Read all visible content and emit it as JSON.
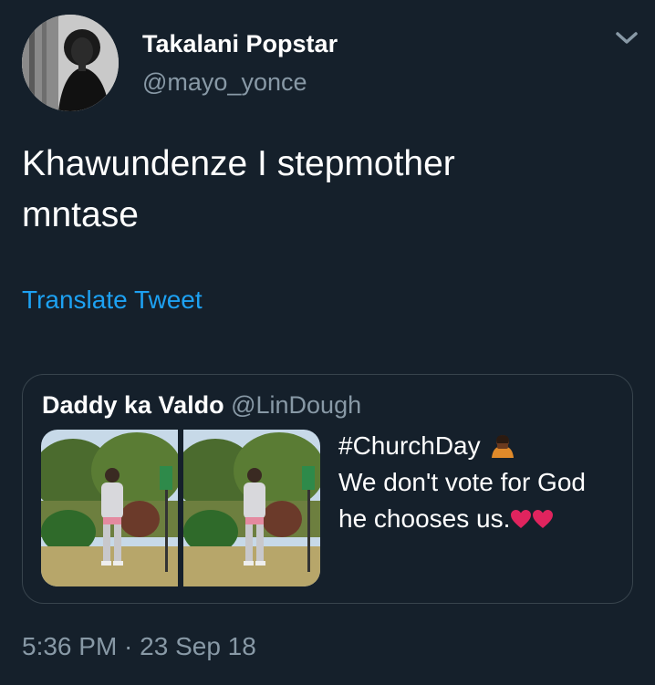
{
  "tweet": {
    "author_name": "Takalani Popstar",
    "author_handle": "@mayo_yonce",
    "text_line1": "Khawundenze I stepmother",
    "text_line2": "mntase",
    "translate_label": "Translate Tweet",
    "timestamp": "5:36 PM · 23 Sep 18",
    "menu_icon": "chevron-down-icon",
    "avatar_icon": "profile-photo"
  },
  "quoted_tweet": {
    "author_name": "Daddy ka Valdo",
    "author_handle": "@LinDough",
    "line1": "#ChurchDay",
    "line2": "We don't vote for God",
    "line3": "he chooses us.",
    "line1_emoji": "person-bowing-emoji",
    "line3_emoji": "red-heart-emoji",
    "media": [
      {
        "description": "photo-left"
      },
      {
        "description": "photo-right"
      }
    ]
  },
  "colors": {
    "background": "#15202b",
    "primary_text": "#ffffff",
    "secondary_text": "#8899a6",
    "link": "#1da1f2",
    "border": "#38444d",
    "heart": "#e0245e"
  }
}
